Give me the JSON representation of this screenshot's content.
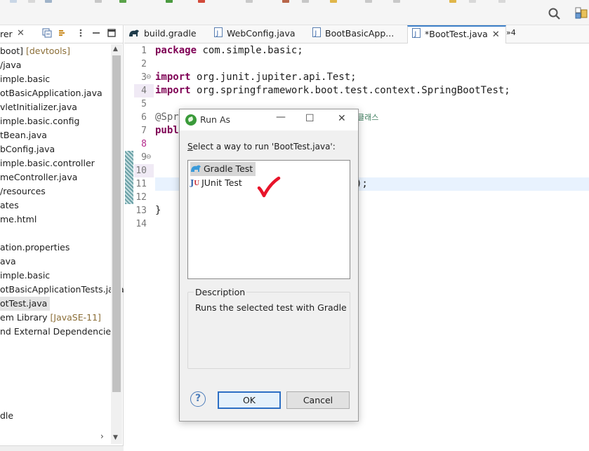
{
  "toolbar": {
    "icons": [
      "search-icon",
      "perspective-icon"
    ]
  },
  "explorer": {
    "title": "rer",
    "tree": [
      {
        "text": "boot]",
        "decor": " [devtools]"
      },
      {
        "text": "/java",
        "decor": ""
      },
      {
        "text": "imple.basic",
        "decor": ""
      },
      {
        "text": "otBasicApplication.java",
        "decor": ""
      },
      {
        "text": "vletInitializer.java",
        "decor": ""
      },
      {
        "text": "imple.basic.config",
        "decor": ""
      },
      {
        "text": "tBean.java",
        "decor": ""
      },
      {
        "text": "bConfig.java",
        "decor": ""
      },
      {
        "text": "imple.basic.controller",
        "decor": ""
      },
      {
        "text": "meController.java",
        "decor": ""
      },
      {
        "text": "/resources",
        "decor": ""
      },
      {
        "text": "ates",
        "decor": ""
      },
      {
        "text": "me.html",
        "decor": ""
      },
      {
        "text": "",
        "decor": ""
      },
      {
        "text": "ation.properties",
        "decor": ""
      },
      {
        "text": "ava",
        "decor": ""
      },
      {
        "text": "imple.basic",
        "decor": ""
      },
      {
        "text": "otBasicApplicationTests.java",
        "decor": ""
      },
      {
        "text": "otTest.java",
        "decor": "",
        "selected": true
      },
      {
        "text": "em Library ",
        "decor": "[JavaSE-11]"
      },
      {
        "text": "nd External Dependencies",
        "decor": ""
      }
    ],
    "bottom_item": "dle"
  },
  "editor": {
    "tabs": [
      {
        "label": "build.gradle",
        "icon": "gradle-icon"
      },
      {
        "label": "WebConfig.java",
        "icon": "java-file-icon"
      },
      {
        "label": "BootBasicApp...",
        "icon": "java-file-icon"
      },
      {
        "label": "*BootTest.java",
        "icon": "java-file-icon",
        "active": true
      }
    ],
    "overflow_label": "»4",
    "line_numbers": [
      "1",
      "2",
      "3",
      "4",
      "5",
      "6",
      "7",
      "8",
      "9",
      "10",
      "11",
      "12",
      "13",
      "14"
    ],
    "lines": {
      "l1_kw": "package",
      "l1_rest": " com.simple.basic;",
      "l3_kw": "import",
      "l3_rest": " org.junit.jupiter.api.Test;",
      "l4_kw": "import",
      "l4_rest": " org.springframework.boot.test.context.SpringBootTest;",
      "l6_ann": "@Spr",
      "l6_comment": "클래스",
      "l7_kw": "publ",
      "l11_tail": ");",
      "l13": "}"
    }
  },
  "dialog": {
    "title": "Run As",
    "prompt_prefix": "elect a way to run 'BootTest.java':",
    "prompt_mnemonic": "S",
    "options": [
      {
        "label": "Gradle Test",
        "icon": "gradle-icon",
        "selected": true
      },
      {
        "label": "JUnit Test",
        "icon": "junit-icon",
        "selected": false
      }
    ],
    "description_label": "Description",
    "description_text": "Runs the selected test with Gradle",
    "ok_label": "OK",
    "cancel_label": "Cancel",
    "help_glyph": "?"
  }
}
